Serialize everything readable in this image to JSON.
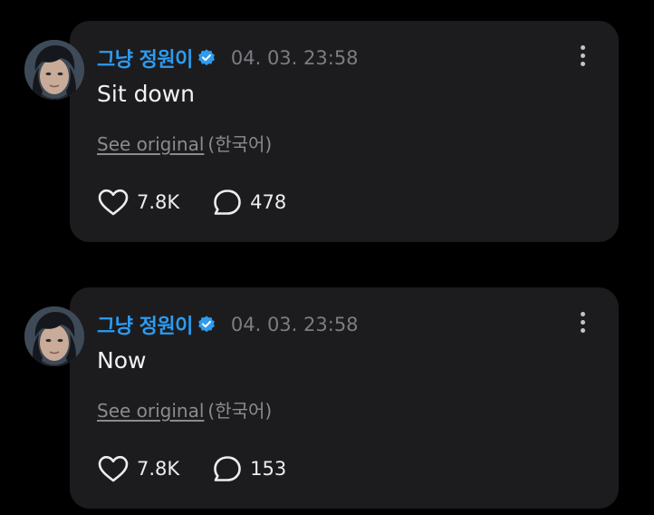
{
  "posts": [
    {
      "username": "그냥 정원이",
      "timestamp": "04. 03. 23:58",
      "text": "Sit down",
      "see_original": "See original",
      "original_language": "(한국어)",
      "likes": "7.8K",
      "comments": "478"
    },
    {
      "username": "그냥 정원이",
      "timestamp": "04. 03. 23:58",
      "text": "Now",
      "see_original": "See original",
      "original_language": "(한국어)",
      "likes": "7.8K",
      "comments": "153"
    }
  ],
  "icons": {
    "verified": "verified-badge-icon",
    "more": "more-vertical-icon",
    "like": "heart-icon",
    "comment": "comment-bubble-icon"
  },
  "colors": {
    "background": "#000000",
    "card": "#1c1c1e",
    "username": "#2d9bf0",
    "verified": "#2d9bf0",
    "timestamp": "#7c7c82",
    "text": "#f2f2f2"
  }
}
